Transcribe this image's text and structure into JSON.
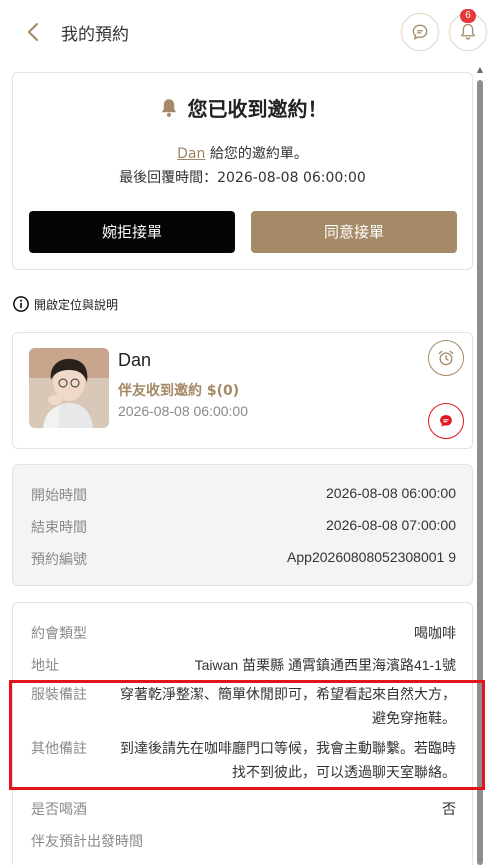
{
  "header": {
    "title": "我的預約",
    "notification_count": "6",
    "chat_icon": "chat-bubble-icon",
    "bell_icon": "bell-icon"
  },
  "invite": {
    "heading": "您已收到邀約！",
    "sender_name": "Dan",
    "sender_suffix": " 給您的邀約單。",
    "deadline": "最後回覆時間：2026-08-08 06:00:00",
    "reject_label": "婉拒接單",
    "accept_label": "同意接單"
  },
  "locate_label": "開啟定位與說明",
  "partner": {
    "name": "Dan",
    "subtitle": "伴友收到邀約 $(0)",
    "time": "2026-08-08 06:00:00"
  },
  "schedule": [
    {
      "label": "開始時間",
      "value": "2026-08-08 06:00:00"
    },
    {
      "label": "結束時間",
      "value": "2026-08-08 07:00:00"
    },
    {
      "label": "預約編號",
      "value": "App20260808052308001 9"
    }
  ],
  "details": {
    "type_label": "約會類型",
    "type_value": "喝咖啡",
    "address_label": "地址",
    "address_value": "Taiwan 苗栗縣 通霄鎮通西里海濱路41-1號",
    "dress_label": "服裝備註",
    "dress_value": "穿著乾淨整潔、簡單休閒即可，希望看起來自然大方，避免穿拖鞋。",
    "other_label": "其他備註",
    "other_value": "到達後請先在咖啡廳門口等候，我會主動聯繫。若臨時找不到彼此，可以透過聊天室聯絡。",
    "alcohol_label": "是否喝酒",
    "alcohol_value": "否",
    "depart_label": "伴友預計出發時間"
  },
  "colors": {
    "accent": "#a48a66",
    "highlight": "#e3141c",
    "reject": "#050505"
  }
}
